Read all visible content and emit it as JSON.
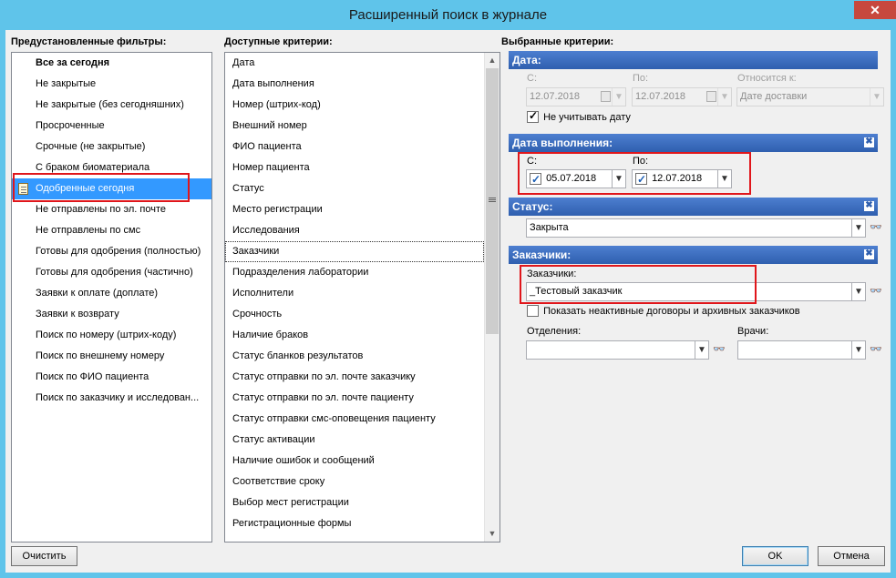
{
  "window": {
    "title": "Расширенный поиск в журнале",
    "close_label": "✕"
  },
  "presets": {
    "header": "Предустановленные фильтры:",
    "items": [
      "Все за сегодня",
      "Не закрытые",
      "Не закрытые (без сегодняшних)",
      "Просроченные",
      "Срочные (не закрытые)",
      "С браком биоматериала",
      "Одобренные сегодня",
      "Не отправлены по эл. почте",
      "Не отправлены по смс",
      "Готовы для одобрения (полностью)",
      "Готовы для одобрения (частично)",
      "Заявки к оплате (доплате)",
      "Заявки к возврату",
      "Поиск по номеру (штрих-коду)",
      "Поиск по внешнему номеру",
      "Поиск по ФИО пациента",
      "Поиск по заказчику и исследован..."
    ],
    "selected_index": 6
  },
  "criteria": {
    "header": "Доступные критерии:",
    "items": [
      "Дата",
      "Дата выполнения",
      "Номер (штрих-код)",
      "Внешний номер",
      "ФИО пациента",
      "Номер пациента",
      "Статус",
      "Место регистрации",
      "Исследования",
      "Заказчики",
      "Подразделения лаборатории",
      "Исполнители",
      "Срочность",
      "Наличие браков",
      "Статус бланков результатов",
      "Статус отправки по эл. почте заказчику",
      "Статус отправки по эл. почте пациенту",
      "Статус отправки смс-оповещения пациенту",
      "Статус активации",
      "Наличие ошибок и сообщений",
      "Соответствие сроку",
      "Выбор мест регистрации",
      "Регистрационные формы"
    ],
    "focused_index": 9,
    "scroll_up": "▲",
    "scroll_down": "▼"
  },
  "selected": {
    "header": "Выбранные критерии:",
    "date": {
      "title": "Дата:",
      "from_label": "С:",
      "from_value": "12.07.2018",
      "to_label": "По:",
      "to_value": "12.07.2018",
      "relates_label": "Относится к:",
      "relates_value": "Дате доставки",
      "ignore_date_label": "Не учитывать дату"
    },
    "exec_date": {
      "title": "Дата выполнения:",
      "from_label": "С:",
      "from_value": "05.07.2018",
      "to_label": "По:",
      "to_value": "12.07.2018"
    },
    "status": {
      "title": "Статус:",
      "value": "Закрыта"
    },
    "customers": {
      "title": "Заказчики:",
      "label": "Заказчики:",
      "value": "_Тестовый заказчик",
      "show_inactive_label": "Показать неактивные договоры и архивных заказчиков",
      "departments_label": "Отделения:",
      "departments_value": "",
      "doctors_label": "Врачи:",
      "doctors_value": ""
    },
    "remove_icon": "✖",
    "dropdown_glyph": "▼",
    "ext_glyph": "👓"
  },
  "buttons": {
    "clear": "Очистить",
    "ok": "OK",
    "cancel": "Отмена"
  }
}
